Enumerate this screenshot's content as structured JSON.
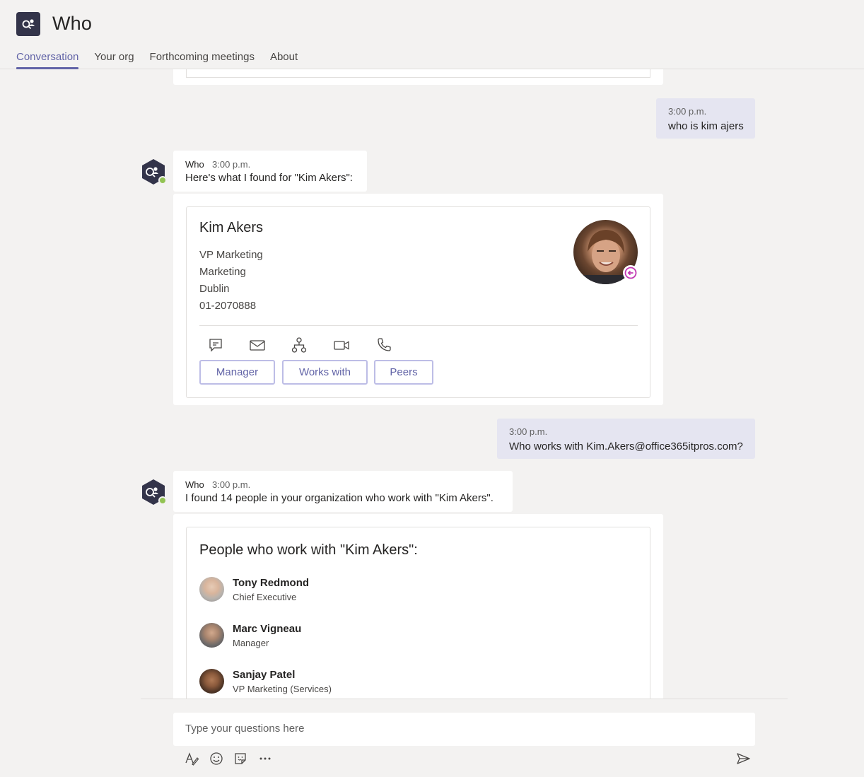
{
  "app": {
    "title": "Who"
  },
  "tabs": [
    {
      "label": "Conversation",
      "active": true
    },
    {
      "label": "Your org",
      "active": false
    },
    {
      "label": "Forthcoming meetings",
      "active": false
    },
    {
      "label": "About",
      "active": false
    }
  ],
  "messages": {
    "user1": {
      "time": "3:00 p.m.",
      "text": "who is kim ajers"
    },
    "bot1": {
      "sender": "Who",
      "time": "3:00 p.m.",
      "text": "Here's what I found for \"Kim Akers\":"
    },
    "profile": {
      "name": "Kim Akers",
      "details": [
        "VP Marketing",
        "Marketing",
        "Dublin",
        "01-2070888"
      ],
      "actions": [
        "chat-icon",
        "mail-icon",
        "org-chart-icon",
        "video-call-icon",
        "phone-icon"
      ],
      "buttons": [
        "Manager",
        "Works with",
        "Peers"
      ]
    },
    "user2": {
      "time": "3:00 p.m.",
      "text": "Who works with Kim.Akers@office365itpros.com?"
    },
    "bot2": {
      "sender": "Who",
      "time": "3:00 p.m.",
      "text": "I found 14 people in your organization who work with \"Kim Akers\"."
    },
    "people_card": {
      "heading": "People who work with \"Kim Akers\":",
      "people": [
        {
          "name": "Tony Redmond",
          "title": "Chief Executive"
        },
        {
          "name": "Marc Vigneau",
          "title": "Manager"
        },
        {
          "name": "Sanjay Patel",
          "title": "VP Marketing (Services)"
        }
      ]
    }
  },
  "composer": {
    "placeholder": "Type your questions here"
  },
  "colors": {
    "accent": "#6264a7",
    "bubble": "#e5e5f1",
    "presence": "#92c353",
    "away": "#c239b3"
  }
}
